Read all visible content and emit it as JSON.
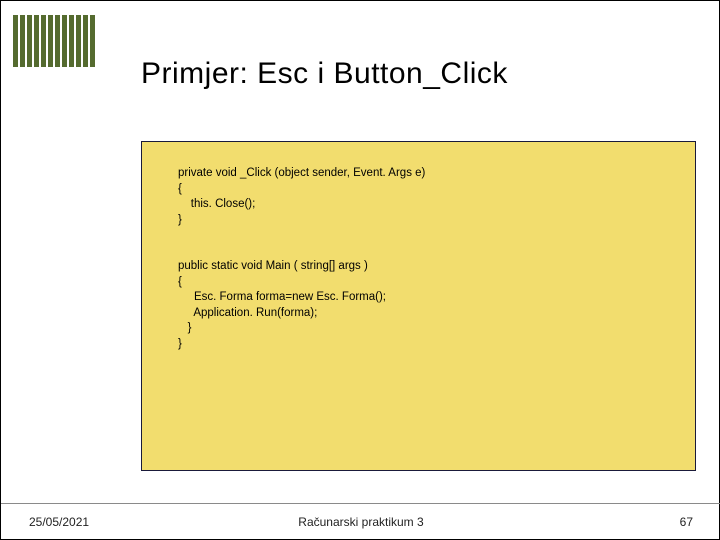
{
  "title": "Primjer: Esc i Button_Click",
  "code": "private void _Click (object sender, Event. Args e)\n{\n    this. Close();\n}\n\n\npublic static void Main ( string[] args )\n{\n     Esc. Forma forma=new Esc. Forma();\n     Application. Run(forma);\n   }\n}",
  "footer": {
    "date": "25/05/2021",
    "center": "Računarski praktikum 3",
    "page": "67"
  },
  "colors": {
    "accent": "#556b2f",
    "code_bg": "#f2dd6e"
  }
}
